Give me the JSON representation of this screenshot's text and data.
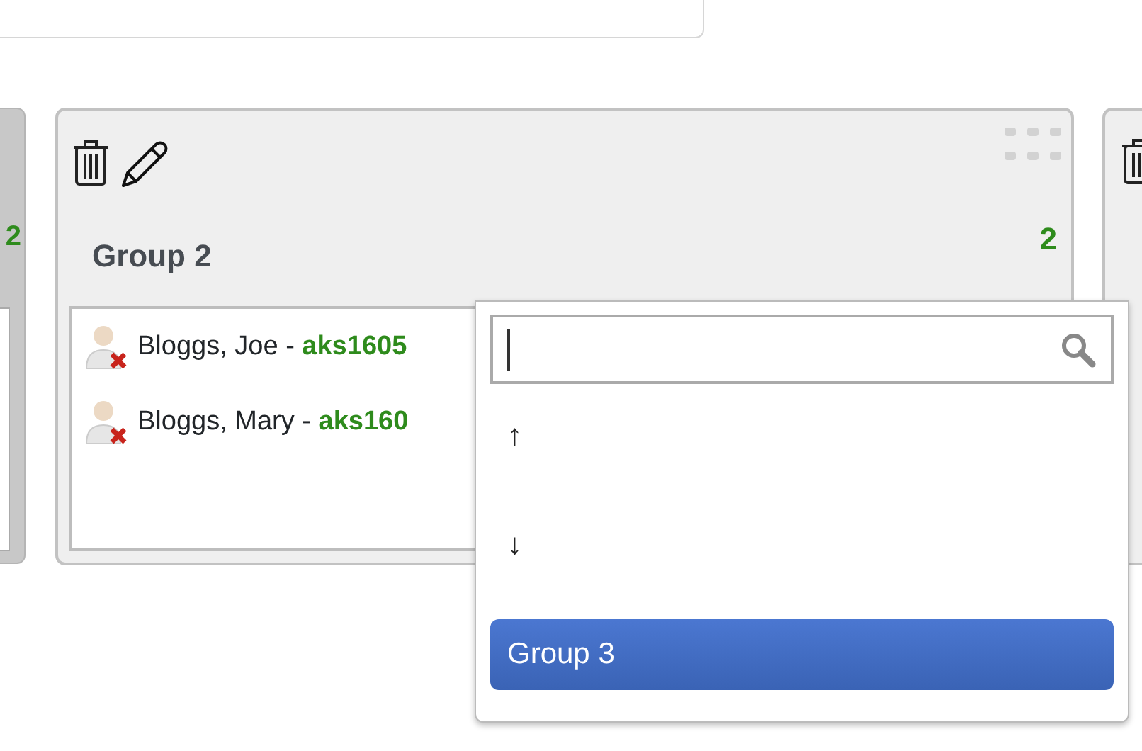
{
  "left_group": {
    "count": "2"
  },
  "group": {
    "title": "Group 2",
    "count": "2",
    "members": [
      {
        "name": "Bloggs, Joe - ",
        "id": "aks1605"
      },
      {
        "name": "Bloggs, Mary - ",
        "id": "aks160"
      }
    ]
  },
  "dropdown": {
    "search": {
      "focused": true
    },
    "options": [
      {
        "label": "↑",
        "selected": false
      },
      {
        "label": "↓",
        "selected": false
      },
      {
        "label": "Group 3",
        "selected": true
      }
    ]
  }
}
